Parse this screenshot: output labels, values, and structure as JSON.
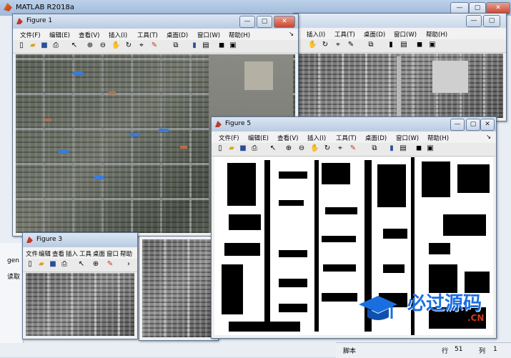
{
  "app": {
    "title": "MATLAB R2018a",
    "window_buttons": [
      "—",
      "▢",
      "✕"
    ]
  },
  "status": {
    "script_label": "脚本",
    "row_label": "行",
    "row_value": "51",
    "col_label": "列",
    "col_value": "1"
  },
  "left_panel": {
    "text1": "gen",
    "text2": "读取"
  },
  "menus": [
    "文件(F)",
    "编辑(E)",
    "查看(V)",
    "插入(I)",
    "工具(T)",
    "桌面(D)",
    "窗口(W)",
    "帮助(H)"
  ],
  "menus_short": [
    "文件",
    "编辑",
    "查看",
    "插入",
    "工具",
    "桌面",
    "窗口",
    "帮助"
  ],
  "menus_back": [
    "插入(I)",
    "工具(T)",
    "桌面(D)",
    "窗口(W)",
    "帮助(H)"
  ],
  "figures": {
    "fig1": {
      "title": "Figure 1"
    },
    "fig3": {
      "title": "Figure 3"
    },
    "fig5": {
      "title": "Figure 5"
    }
  },
  "watermark": {
    "text": "必过源码",
    "domain": ".CN"
  },
  "colors": {
    "title_bar": "#b9cbe2",
    "accent_blue": "#1a6fe0",
    "watermark_red": "#d03b1c"
  }
}
